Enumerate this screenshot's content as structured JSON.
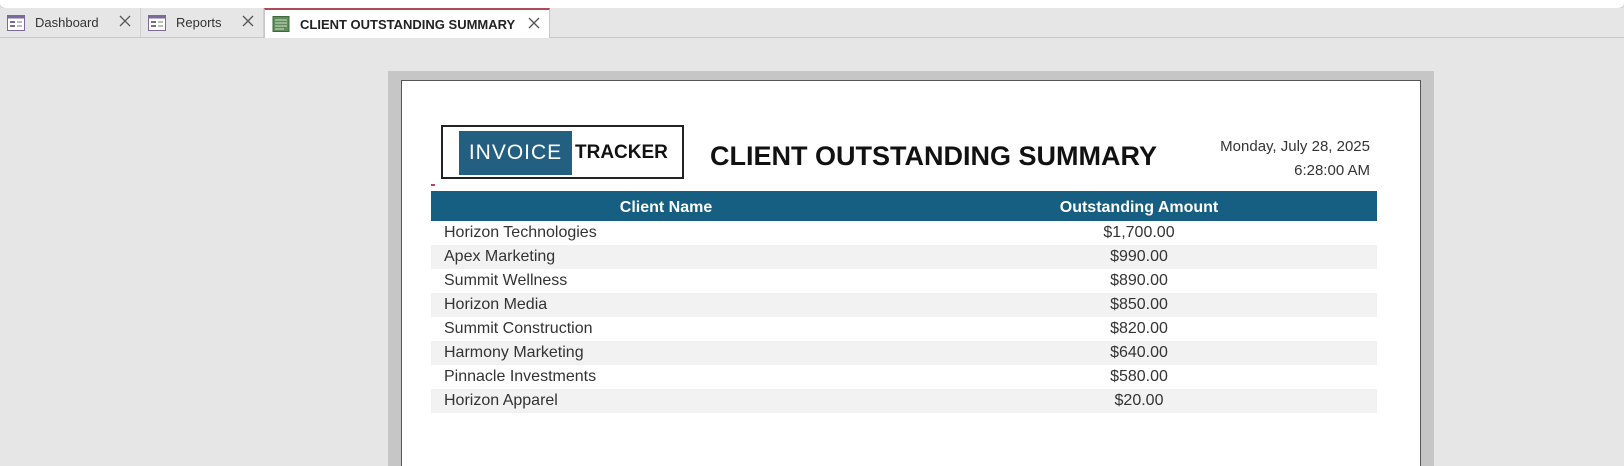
{
  "tabs": [
    {
      "label": "Dashboard",
      "icon": "form-icon",
      "active": false
    },
    {
      "label": "Reports",
      "icon": "form-icon",
      "active": false
    },
    {
      "label": "CLIENT OUTSTANDING SUMMARY",
      "icon": "report-icon",
      "active": true
    }
  ],
  "report": {
    "logo_left": "INVOICE",
    "logo_right": "TRACKER",
    "title": "CLIENT OUTSTANDING SUMMARY",
    "date": "Monday, July 28, 2025",
    "time": "6:28:00 AM",
    "columns": {
      "name": "Client Name",
      "amount": "Outstanding Amount"
    },
    "rows": [
      {
        "name": "Horizon Technologies",
        "amount": "$1,700.00"
      },
      {
        "name": "Apex Marketing",
        "amount": "$990.00"
      },
      {
        "name": "Summit Wellness",
        "amount": "$890.00"
      },
      {
        "name": "Horizon Media",
        "amount": "$850.00"
      },
      {
        "name": "Summit Construction",
        "amount": "$820.00"
      },
      {
        "name": "Harmony Marketing",
        "amount": "$640.00"
      },
      {
        "name": "Pinnacle Investments",
        "amount": "$580.00"
      },
      {
        "name": "Horizon Apparel",
        "amount": "$20.00"
      }
    ]
  },
  "colors": {
    "header_fill": "#175f82",
    "logo_fill": "#235f80",
    "active_tab_accent": "#b04a5a",
    "alt_row": "#f2f2f2"
  }
}
